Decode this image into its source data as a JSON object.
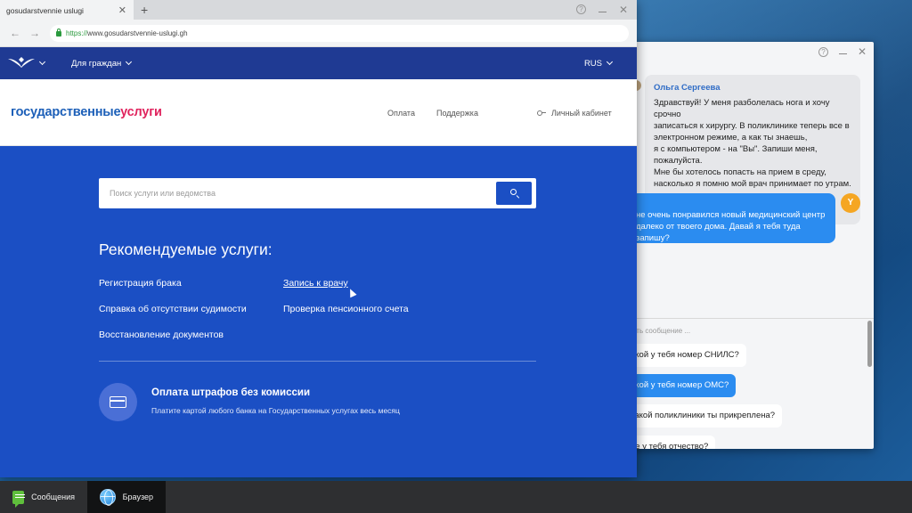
{
  "browser": {
    "tab_title": "gosudarstvennie uslugi",
    "url_scheme": "https://",
    "url_rest": "www.gosudarstvennie-uslugi.gh"
  },
  "site": {
    "nav_citizens": "Для граждан",
    "nav_lang": "RUS",
    "logo_part1": "государственные",
    "logo_part2": "услуги",
    "header_links": {
      "payment": "Оплата",
      "support": "Поддержка",
      "account": "Личный кабинет"
    },
    "search_placeholder": "Поиск услуги или ведомства",
    "recommended_title": "Рекомендуемые услуги:",
    "services": [
      "Регистрация брака",
      "Запись к врачу",
      "Справка об отсутствии судимости",
      "Проверка пенсионного счета",
      "Восстановление документов"
    ],
    "fines_title": "Оплата штрафов без комиссии",
    "fines_subtitle": "Платите картой любого банка на Государственных услугах весь месяц"
  },
  "messenger": {
    "incoming_author": "Ольга Сергеева",
    "incoming_text": "Здравствуй! У меня разболелась нога и хочу срочно\nзаписаться к хирургу. В поликлинике теперь все в\nэлектронном режиме, а как ты знаешь,\nя с компьютером  - на \"Вы\". Запиши меня,\nпожалуйста.\nМне бы хотелось попасть на прием в среду,\nнасколько я помню мой врач принимает по утрам.",
    "outgoing_text": "не очень понравился новый медицинский центр\nдалеко от твоего дома. Давай я тебя туда запишу?",
    "avatar_letter": "Y",
    "input_placeholder": "ать сообщение ...",
    "quick_replies": [
      "акой у тебя номер СНИЛС?",
      "акой у тебя номер ОМС?",
      "какой поликлиники ты прикреплена?",
      "ое у тебя отчество?"
    ]
  },
  "taskbar": {
    "items": [
      "Сообщения",
      "Браузер"
    ]
  }
}
